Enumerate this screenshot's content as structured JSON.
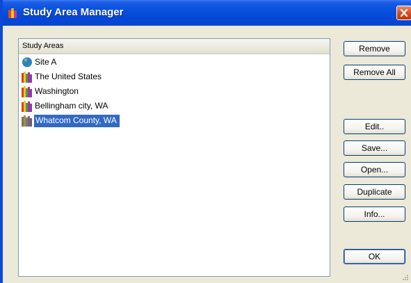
{
  "window": {
    "title": "Study Area Manager"
  },
  "list": {
    "header": "Study Areas",
    "items": [
      {
        "label": "Site A",
        "icon": "globe-icon",
        "selected": false
      },
      {
        "label": "The United States",
        "icon": "books-icon",
        "selected": false
      },
      {
        "label": "Washington",
        "icon": "books-icon",
        "selected": false
      },
      {
        "label": "Bellingham city, WA",
        "icon": "books-icon",
        "selected": false
      },
      {
        "label": "Whatcom County, WA",
        "icon": "books-gray-icon",
        "selected": true
      }
    ]
  },
  "buttons": {
    "remove": "Remove",
    "remove_all": "Remove All",
    "edit": "Edit..",
    "save": "Save...",
    "open": "Open...",
    "duplicate": "Duplicate",
    "info": "Info...",
    "ok": "OK"
  },
  "colors": {
    "titlebar": "#0a54e0",
    "selection": "#316ac5",
    "dialog_bg": "#ece9d8"
  }
}
